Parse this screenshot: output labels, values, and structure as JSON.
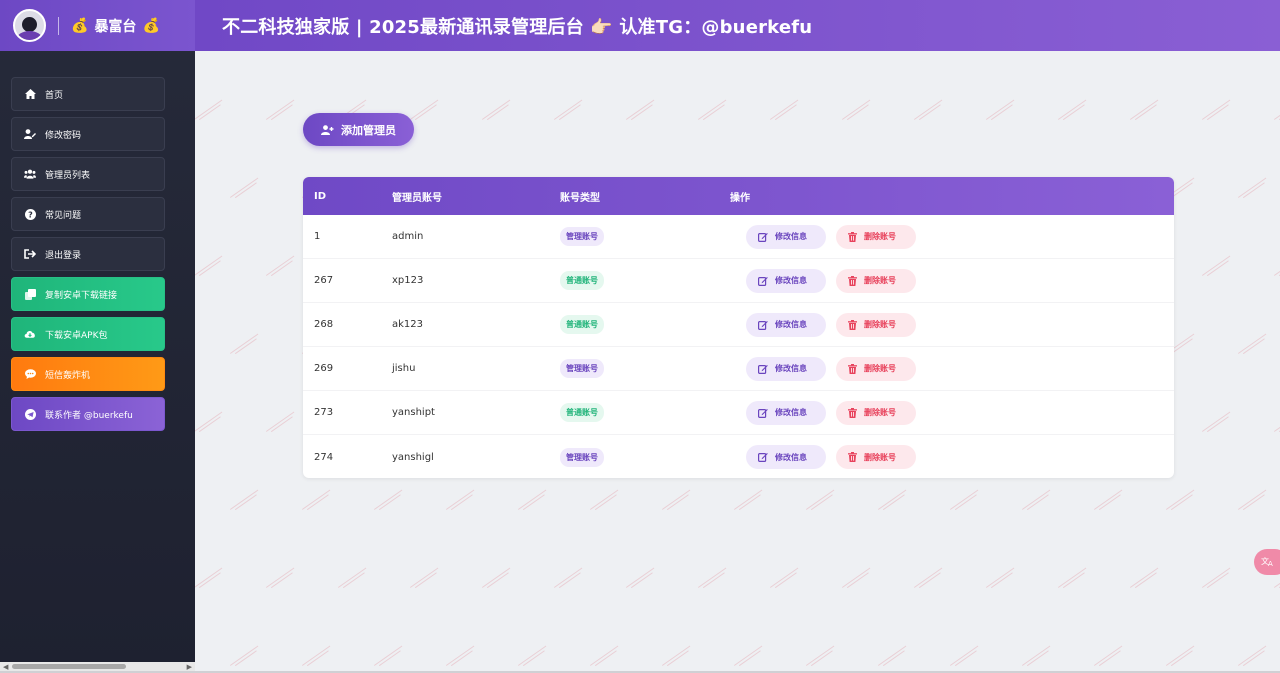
{
  "brand": {
    "name": "暴富台"
  },
  "header": {
    "title": "不二科技独家版 | 2025最新通讯录管理后台 👉🏻 认准TG：@buerkefu"
  },
  "sidebar": {
    "items": [
      {
        "label": "首页",
        "icon": "home-icon"
      },
      {
        "label": "修改密码",
        "icon": "user-edit-icon"
      },
      {
        "label": "管理员列表",
        "icon": "users-icon"
      },
      {
        "label": "常见问题",
        "icon": "question-icon"
      },
      {
        "label": "退出登录",
        "icon": "logout-icon"
      },
      {
        "label": "复制安卓下载链接",
        "icon": "copy-icon"
      },
      {
        "label": "下载安卓APK包",
        "icon": "cloud-download-icon"
      },
      {
        "label": "短信轰炸机",
        "icon": "message-icon"
      },
      {
        "label": "联系作者 @buerkefu",
        "icon": "telegram-icon"
      }
    ]
  },
  "main": {
    "add_label": "添加管理员",
    "table": {
      "headers": {
        "id": "ID",
        "account": "管理员账号",
        "type": "账号类型",
        "ops": "操作"
      },
      "edit_label": "修改信息",
      "delete_label": "删除账号",
      "rows": [
        {
          "id": "1",
          "account": "admin",
          "type": "管理账号",
          "kind": "admin"
        },
        {
          "id": "267",
          "account": "xp123",
          "type": "普通账号",
          "kind": "normal"
        },
        {
          "id": "268",
          "account": "ak123",
          "type": "普通账号",
          "kind": "normal"
        },
        {
          "id": "269",
          "account": "jishu",
          "type": "管理账号",
          "kind": "admin"
        },
        {
          "id": "273",
          "account": "yanshipt",
          "type": "普通账号",
          "kind": "normal"
        },
        {
          "id": "274",
          "account": "yanshigl",
          "type": "管理账号",
          "kind": "admin"
        }
      ]
    }
  },
  "colors": {
    "accent": "#7048c6",
    "success": "#21b47a",
    "danger": "#e8425c",
    "warning": "#ff8a10"
  }
}
